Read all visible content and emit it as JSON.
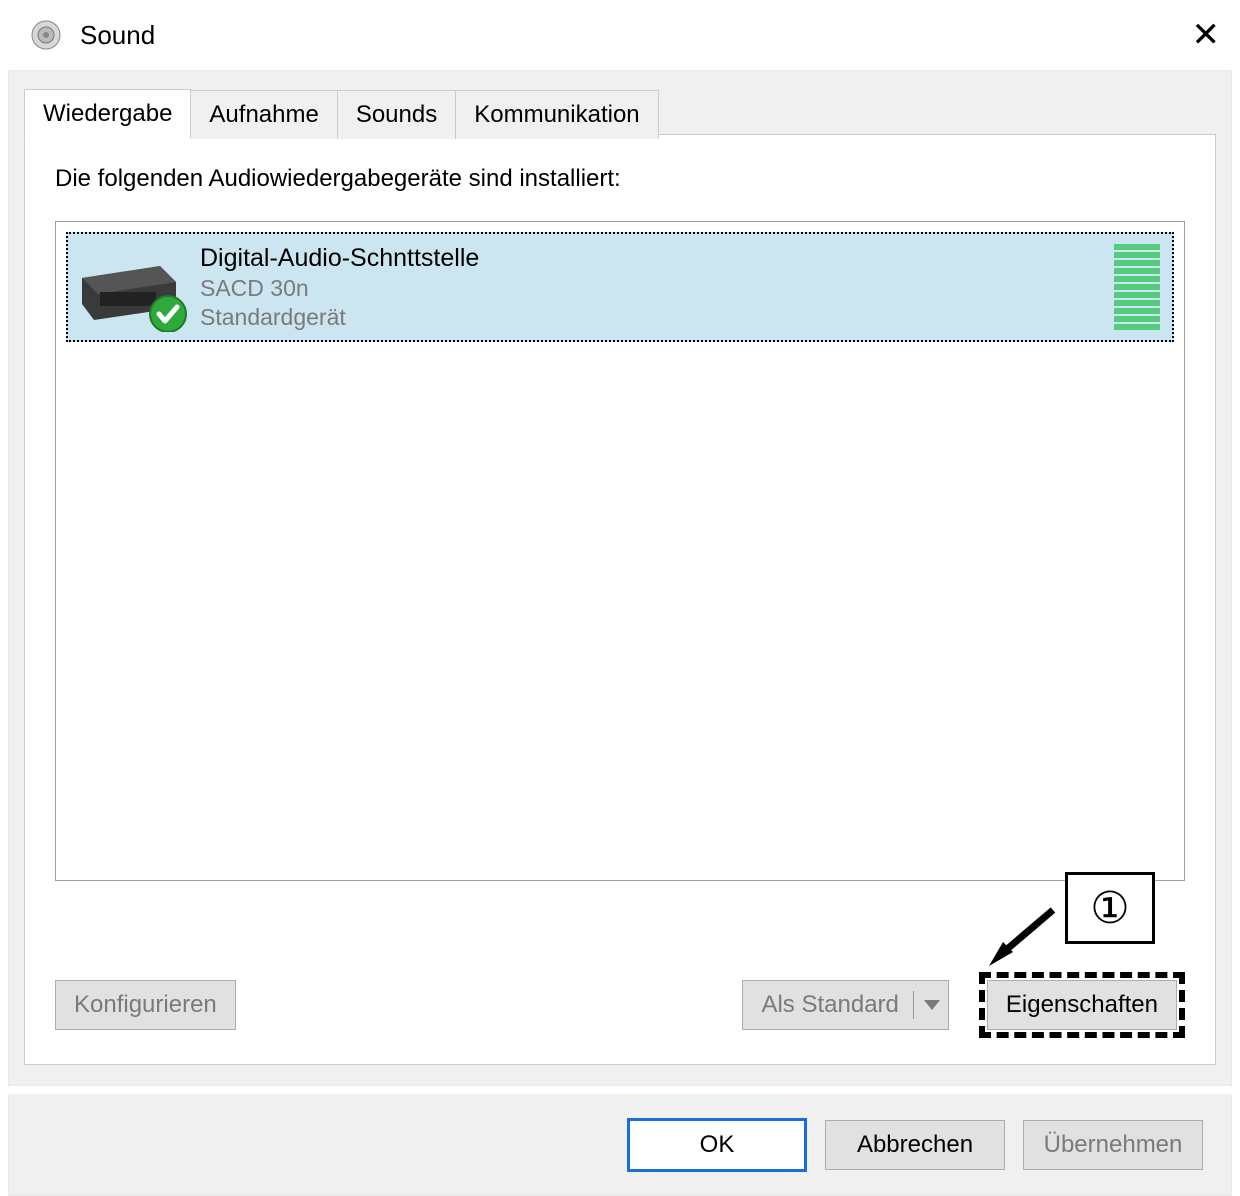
{
  "window": {
    "title": "Sound",
    "close_glyph": "✕"
  },
  "tabs": [
    {
      "label": "Wiedergabe",
      "active": true
    },
    {
      "label": "Aufnahme"
    },
    {
      "label": "Sounds"
    },
    {
      "label": "Kommunikation"
    }
  ],
  "panel": {
    "instruction": "Die folgenden Audiowiedergabegeräte sind installiert:"
  },
  "devices": [
    {
      "name": "Digital-Audio-Schnttstelle",
      "line2": "SACD 30n",
      "status": "Standardgerät",
      "selected": true,
      "default": true
    }
  ],
  "buttons": {
    "configure": "Konfigurieren",
    "set_default": "Als Standard",
    "properties": "Eigenschaften",
    "ok": "OK",
    "cancel": "Abbrechen",
    "apply": "Übernehmen"
  },
  "callout": {
    "label": "①"
  }
}
